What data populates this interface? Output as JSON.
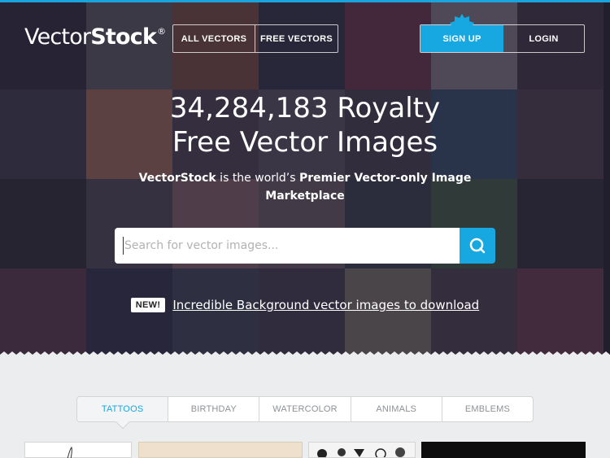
{
  "brand": {
    "name_light": "Vector",
    "name_bold": "Stock",
    "mark": "®"
  },
  "nav": {
    "all_vectors": "ALL VECTORS",
    "free_vectors": "FREE VECTORS"
  },
  "auth": {
    "signup": "SIGN UP",
    "login": "LOGIN"
  },
  "hero": {
    "title_line1": "34,284,183 Royalty",
    "title_line2": "Free Vector Images",
    "sub_brand": "VectorStock",
    "sub_mid": " is the world’s ",
    "sub_bold": "Premier Vector-only Image Marketplace"
  },
  "search": {
    "placeholder": "Search for vector images...",
    "button_icon": "search-icon"
  },
  "promo": {
    "badge": "NEW!",
    "link": "Incredible Background vector images to download"
  },
  "categories": [
    {
      "label": "TATTOOS",
      "active": true
    },
    {
      "label": "BIRTHDAY",
      "active": false
    },
    {
      "label": "WATERCOLOR",
      "active": false
    },
    {
      "label": "ANIMALS",
      "active": false
    },
    {
      "label": "EMBLEMS",
      "active": false
    }
  ],
  "colors": {
    "accent": "#17a8e1",
    "hero_overlay": "#1a1828",
    "page_bg": "#ecedee"
  }
}
